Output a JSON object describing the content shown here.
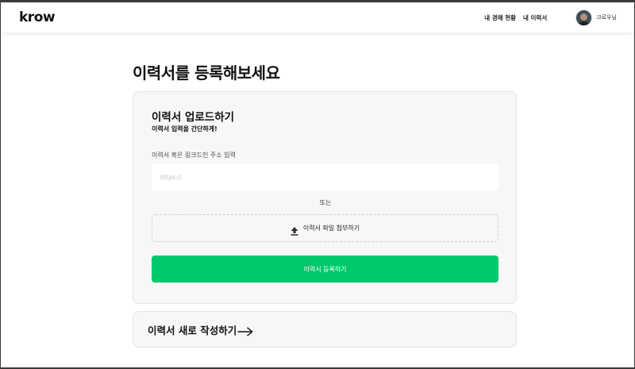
{
  "header": {
    "logo": "krow",
    "nav": [
      {
        "label": "내 경매 현황"
      },
      {
        "label": "내 이력서"
      }
    ],
    "user": {
      "name": "크로우님",
      "avatar_icon": "user-avatar"
    }
  },
  "main": {
    "title": "이력서를 등록해보세요",
    "upload_card": {
      "title": "이력서 업로드하기",
      "subtitle": "이력서 입력을 간단하게!",
      "field_label": "이력서 혹은 링크드인 주소 입력",
      "url_input": {
        "value": "",
        "placeholder": "https://"
      },
      "or_text": "또는",
      "attach_button": {
        "label": "이력서 파일 첨부하기",
        "icon": "upload-icon"
      },
      "submit_button": {
        "label": "이력서 등록하기"
      }
    },
    "write_card": {
      "label": "이력서 새로 작성하기",
      "icon": "arrow-right-icon"
    }
  },
  "colors": {
    "accent": "#00c96b",
    "card_bg": "#f7f7f8",
    "text": "#111111"
  }
}
